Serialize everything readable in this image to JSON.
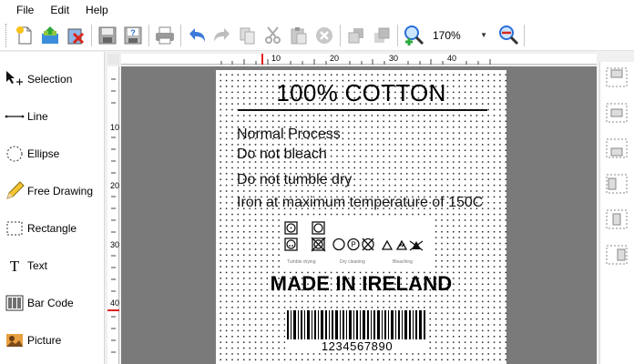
{
  "menu": {
    "items": [
      "File",
      "Edit",
      "Help"
    ]
  },
  "toolbar": {
    "buttons": [
      "new-icon",
      "open-icon",
      "delete-icon",
      "save-icon",
      "help-icon",
      "print-icon",
      "undo-icon",
      "redo-icon",
      "copy-icon",
      "cut-icon",
      "paste-icon",
      "cancel-icon",
      "send-back-icon",
      "bring-front-icon",
      "zoom-in-icon",
      "zoom-out-icon"
    ],
    "zoom_value": "170%"
  },
  "tools": [
    {
      "label": "Selection",
      "icon": "selection-icon"
    },
    {
      "label": "Line",
      "icon": "line-icon"
    },
    {
      "label": "Ellipse",
      "icon": "ellipse-icon"
    },
    {
      "label": "Free Drawing",
      "icon": "pencil-icon"
    },
    {
      "label": "Rectangle",
      "icon": "rectangle-icon"
    },
    {
      "label": "Text",
      "icon": "text-icon"
    },
    {
      "label": "Bar Code",
      "icon": "barcode-icon"
    },
    {
      "label": "Picture",
      "icon": "picture-icon"
    }
  ],
  "rulers": {
    "horizontal_ticks": [
      "10",
      "20",
      "30",
      "40"
    ],
    "vertical_ticks": [
      "10",
      "20",
      "30",
      "40"
    ]
  },
  "label": {
    "title": "100% COTTON",
    "lines": [
      "Normal Process",
      "Do not bleach",
      "Do not tumble dry",
      "Iron at maximum temperature of 150C"
    ],
    "care_captions": [
      "Tumble drying",
      "Dry cleaning",
      "Bleaching"
    ],
    "made_in": "MADE IN IRELAND",
    "barcode_number": "1234567890"
  },
  "colors": {
    "ruler_marker": "#e02020",
    "canvas_bg": "#7a7a7a",
    "accent_blue": "#2a6fd6"
  }
}
